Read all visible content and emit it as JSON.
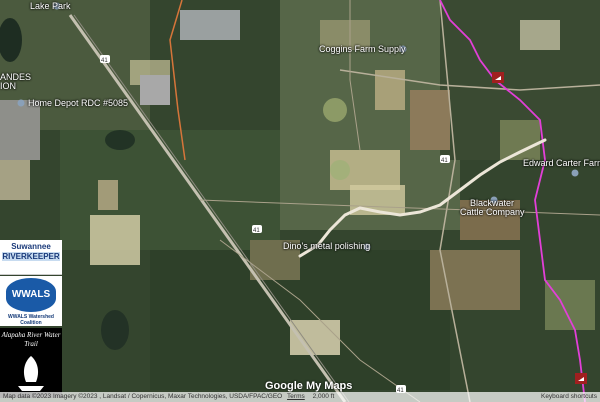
{
  "map": {
    "labels": {
      "lake_park": "Lake Park",
      "home_depot": "Home Depot RDC #5085",
      "coggins": "Coggins Farm Supply",
      "edward_carter": "Edward Carter Farms",
      "blackwater_line1": "Blackwater",
      "blackwater_line2": "Cattle Company",
      "dinos": "Dino's metal polishing",
      "andes_fragment": "ANDES",
      "ion_fragment": "ION",
      "road_41_a": "41",
      "road_41_b": "41",
      "road_41_c": "41",
      "road_41_d": "41"
    },
    "colors": {
      "route": "#ece6d8",
      "boundary": "#e23fd8",
      "orange_road": "#d6753a"
    }
  },
  "sidebar": {
    "suwannee": "Suwannee",
    "riverkeeper": "RIVERKEEPER",
    "wwals": "WWALS",
    "wwals_sub": "WWALS Watershed Coalition",
    "alapaha": "Alapaha River Water Trail"
  },
  "branding": {
    "google_my_maps": "Google My Maps"
  },
  "footer": {
    "attribution": "Map data ©2023 Imagery ©2023 , Landsat / Copernicus, Maxar Technologies, USDA/FPAC/GEO",
    "terms": "Terms",
    "scale": "2,000 ft",
    "shortcuts": "Keyboard shortcuts"
  }
}
